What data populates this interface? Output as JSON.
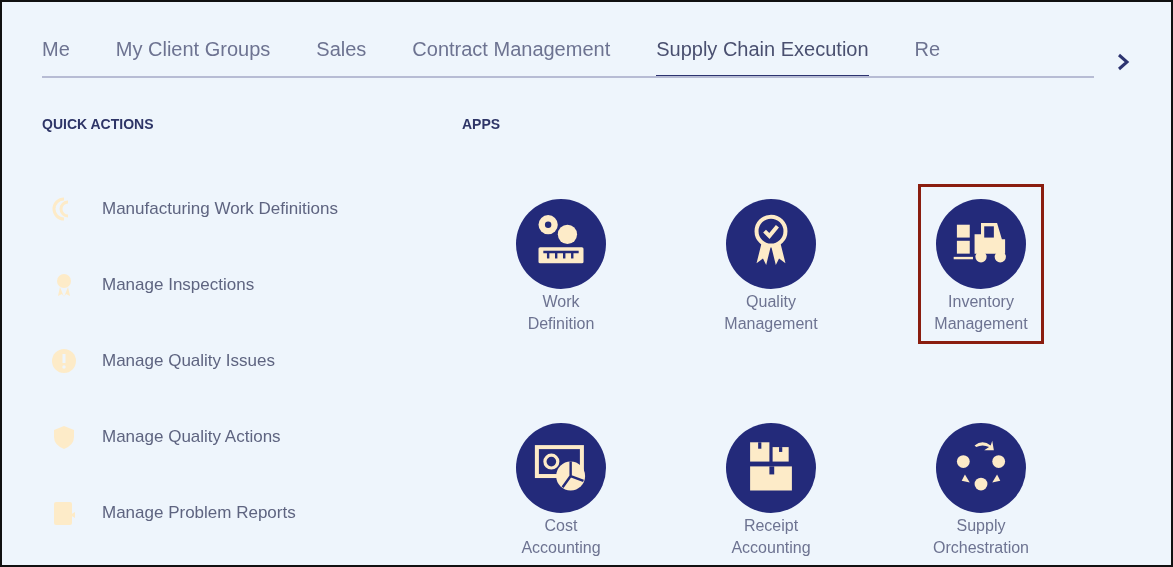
{
  "tabs": [
    {
      "label": "Me",
      "selected": false
    },
    {
      "label": "My Client Groups",
      "selected": false
    },
    {
      "label": "Sales",
      "selected": false
    },
    {
      "label": "Contract Management",
      "selected": false
    },
    {
      "label": "Supply Chain Execution",
      "selected": true
    },
    {
      "label": "Re",
      "selected": false
    }
  ],
  "quick_actions": {
    "title": "QUICK ACTIONS",
    "items": [
      {
        "label": "Manufacturing Work Definitions"
      },
      {
        "label": "Manage Inspections"
      },
      {
        "label": "Manage Quality Issues"
      },
      {
        "label": "Manage Quality Actions"
      },
      {
        "label": "Manage Problem Reports"
      }
    ]
  },
  "apps": {
    "title": "APPS",
    "items": [
      {
        "label": "Work Definition",
        "highlighted": false
      },
      {
        "label": "Quality Management",
        "highlighted": false
      },
      {
        "label": "Inventory Management",
        "highlighted": true
      },
      {
        "label": "Cost Accounting",
        "highlighted": false
      },
      {
        "label": "Receipt Accounting",
        "highlighted": false
      },
      {
        "label": "Supply Orchestration",
        "highlighted": false
      }
    ]
  }
}
